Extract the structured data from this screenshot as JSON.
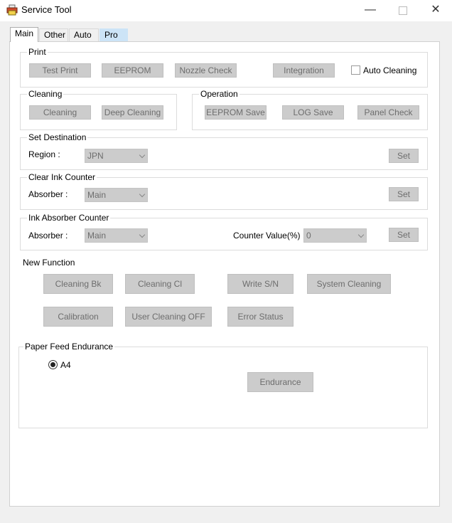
{
  "window": {
    "title": "Service Tool",
    "icon": "printer-icon",
    "minimize": "—",
    "close": "✕"
  },
  "tabs": [
    {
      "label": "Main",
      "active": true
    },
    {
      "label": "Other",
      "active": false
    },
    {
      "label": "Auto",
      "active": false
    },
    {
      "label": "Pro",
      "active": false
    }
  ],
  "print": {
    "title": "Print",
    "test_print": "Test Print",
    "eeprom": "EEPROM",
    "nozzle_check": "Nozzle Check",
    "integration": "Integration",
    "auto_cleaning": "Auto Cleaning"
  },
  "cleaning": {
    "title": "Cleaning",
    "cleaning": "Cleaning",
    "deep_cleaning": "Deep Cleaning"
  },
  "operation": {
    "title": "Operation",
    "eeprom_save": "EEPROM Save",
    "log_save": "LOG Save",
    "panel_check": "Panel Check"
  },
  "set_destination": {
    "title": "Set Destination",
    "region_label": "Region :",
    "region_value": "JPN",
    "set": "Set"
  },
  "clear_ink_counter": {
    "title": "Clear Ink Counter",
    "absorber_label": "Absorber :",
    "absorber_value": "Main",
    "set": "Set"
  },
  "ink_absorber_counter": {
    "title": "Ink Absorber Counter",
    "absorber_label": "Absorber :",
    "absorber_value": "Main",
    "counter_label": "Counter Value(%) :",
    "counter_value": "0",
    "set": "Set"
  },
  "new_function": {
    "title": "New Function",
    "cleaning_bk": "Cleaning Bk",
    "cleaning_cl": "Cleaning Cl",
    "write_sn": "Write S/N",
    "system_cleaning": "System Cleaning",
    "calibration": "Calibration",
    "user_cleaning_off": "User Cleaning OFF",
    "error_status": "Error Status"
  },
  "paper_feed": {
    "title": "Paper Feed Endurance",
    "a4": "A4",
    "endurance": "Endurance"
  }
}
